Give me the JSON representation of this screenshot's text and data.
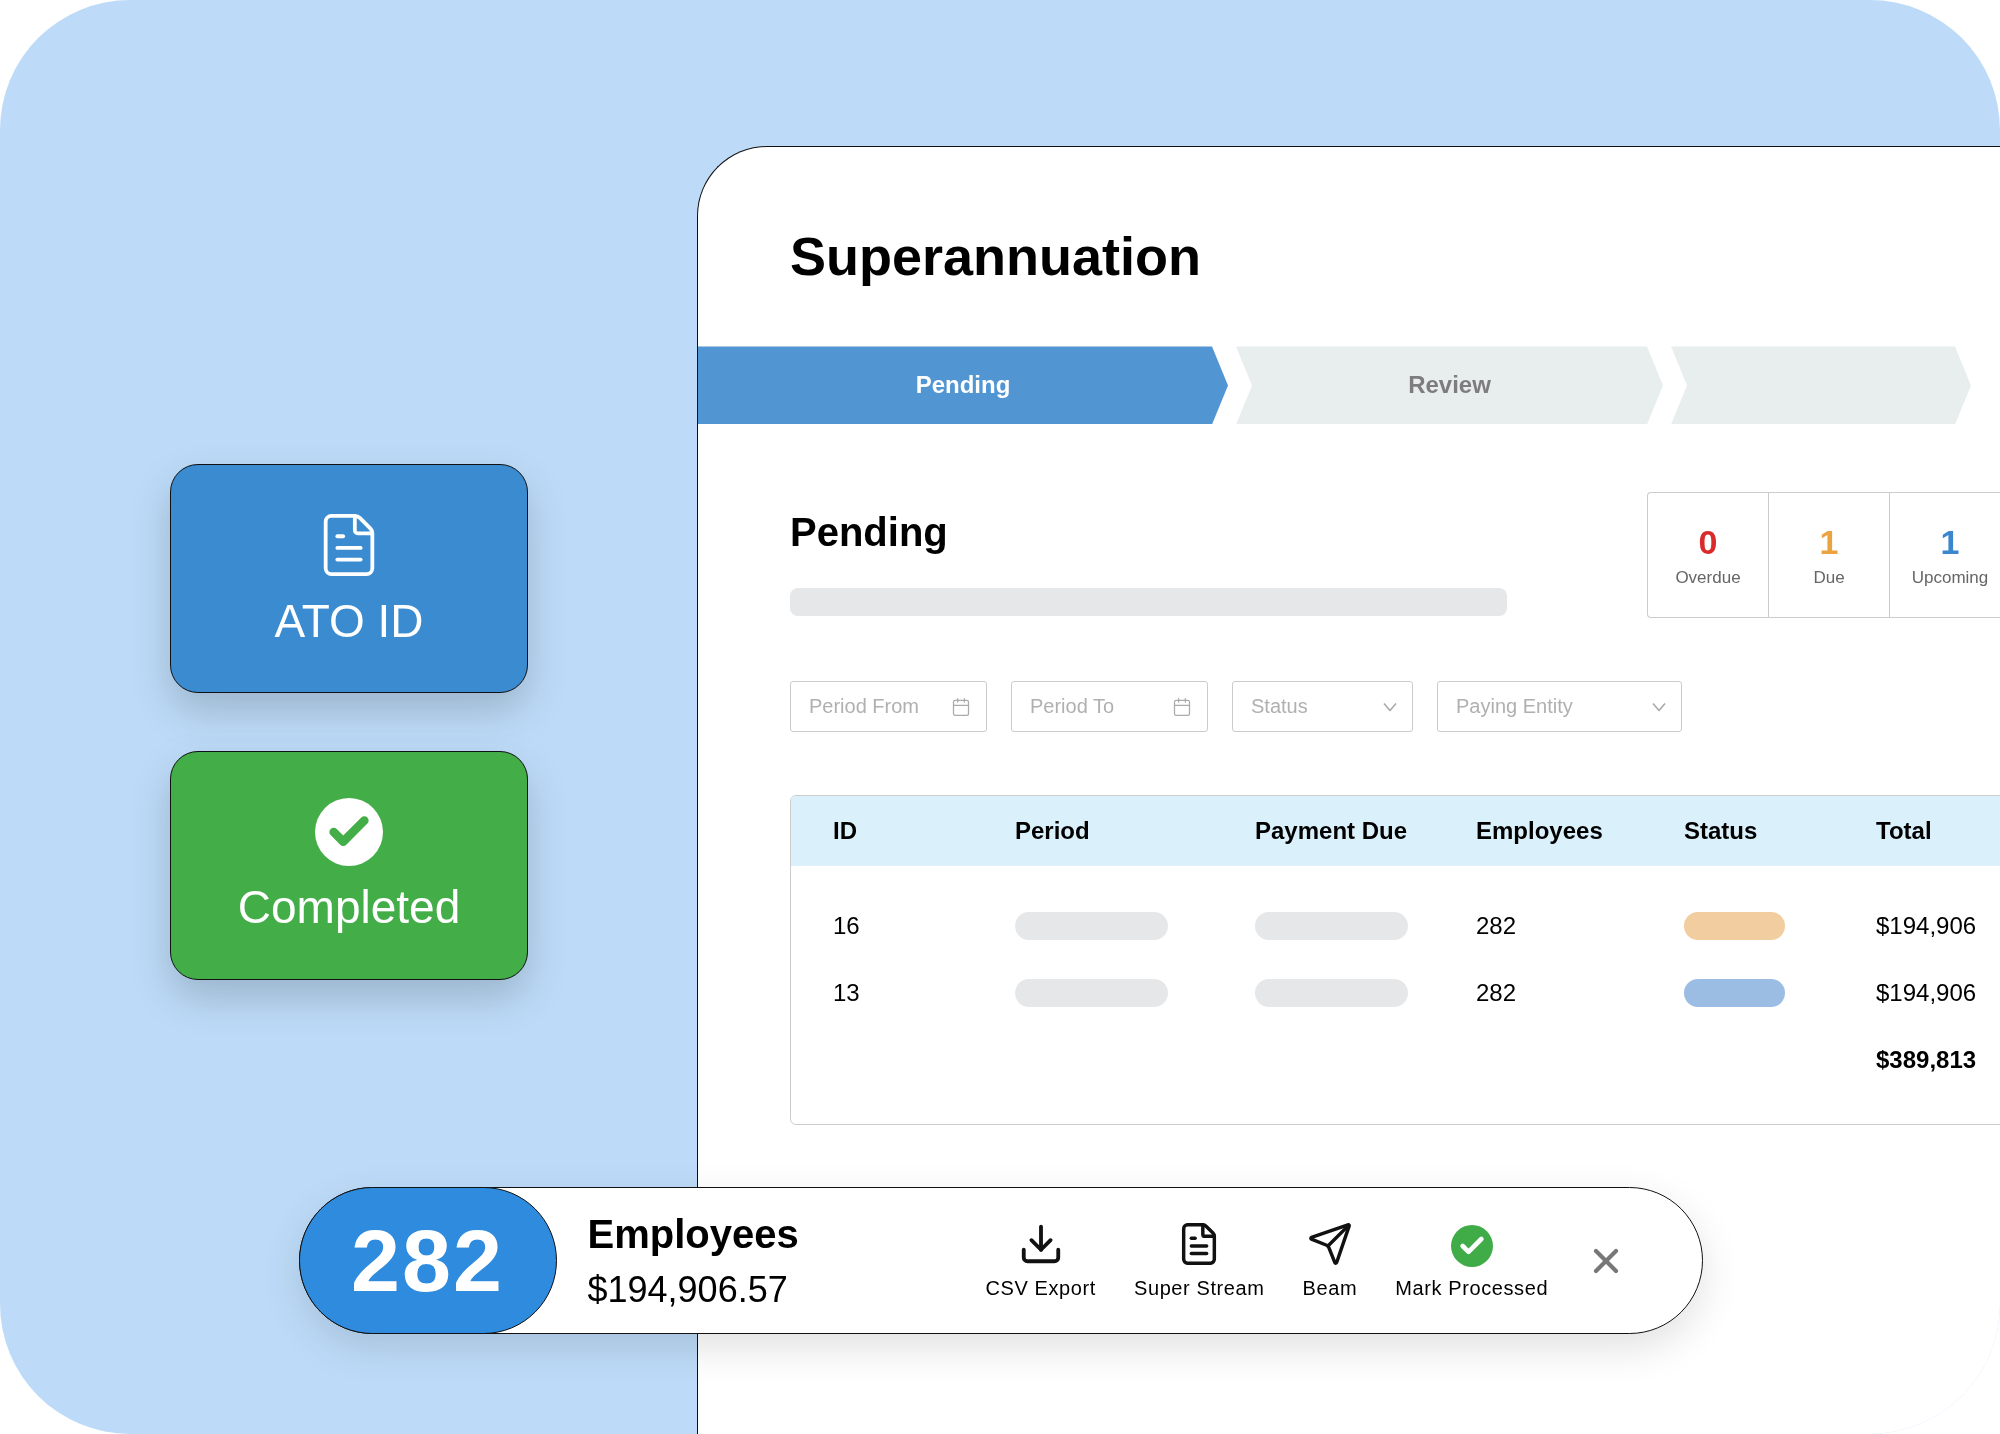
{
  "cards": [
    {
      "kind": "document",
      "label": "ATO ID",
      "color": "#3b8bd0"
    },
    {
      "kind": "check",
      "label": "Completed",
      "color": "#43ad48"
    }
  ],
  "window": {
    "title": "Superannuation"
  },
  "steps": [
    {
      "label": "Pending",
      "selected": true
    },
    {
      "label": "Review",
      "selected": false
    },
    {
      "selected": false
    }
  ],
  "section": {
    "title": "Pending"
  },
  "stats": [
    {
      "value": "0",
      "label": "Overdue",
      "color": "#d92b2b"
    },
    {
      "value": "1",
      "label": "Due",
      "color": "#e9a440"
    },
    {
      "value": "1",
      "label": "Upcoming",
      "color": "#3a87cd"
    }
  ],
  "filters": [
    {
      "placeholder": "Period From",
      "kind": "date"
    },
    {
      "placeholder": "Period To",
      "kind": "date"
    },
    {
      "placeholder": "Status",
      "kind": "select"
    },
    {
      "placeholder": "Paying Entity",
      "kind": "select"
    }
  ],
  "table": {
    "columns": [
      "ID",
      "Period",
      "Payment Due",
      "Employees",
      "Status",
      "Total"
    ],
    "rows": [
      {
        "id": "16",
        "employees": "282",
        "color": "#f2cd9f",
        "total": "$194,906"
      },
      {
        "id": "13",
        "employees": "282",
        "color": "#9cbde3",
        "total": "$194,906"
      }
    ],
    "grand_total": "$389,813"
  },
  "action_bar": {
    "count": "282",
    "title": "Employees",
    "amount": "$194,906.57",
    "actions": [
      {
        "kind": "download",
        "label": "CSV Export"
      },
      {
        "kind": "document",
        "label": "Super Stream"
      },
      {
        "kind": "send",
        "label": "Beam"
      },
      {
        "kind": "check",
        "label": "Mark Processed"
      }
    ]
  }
}
